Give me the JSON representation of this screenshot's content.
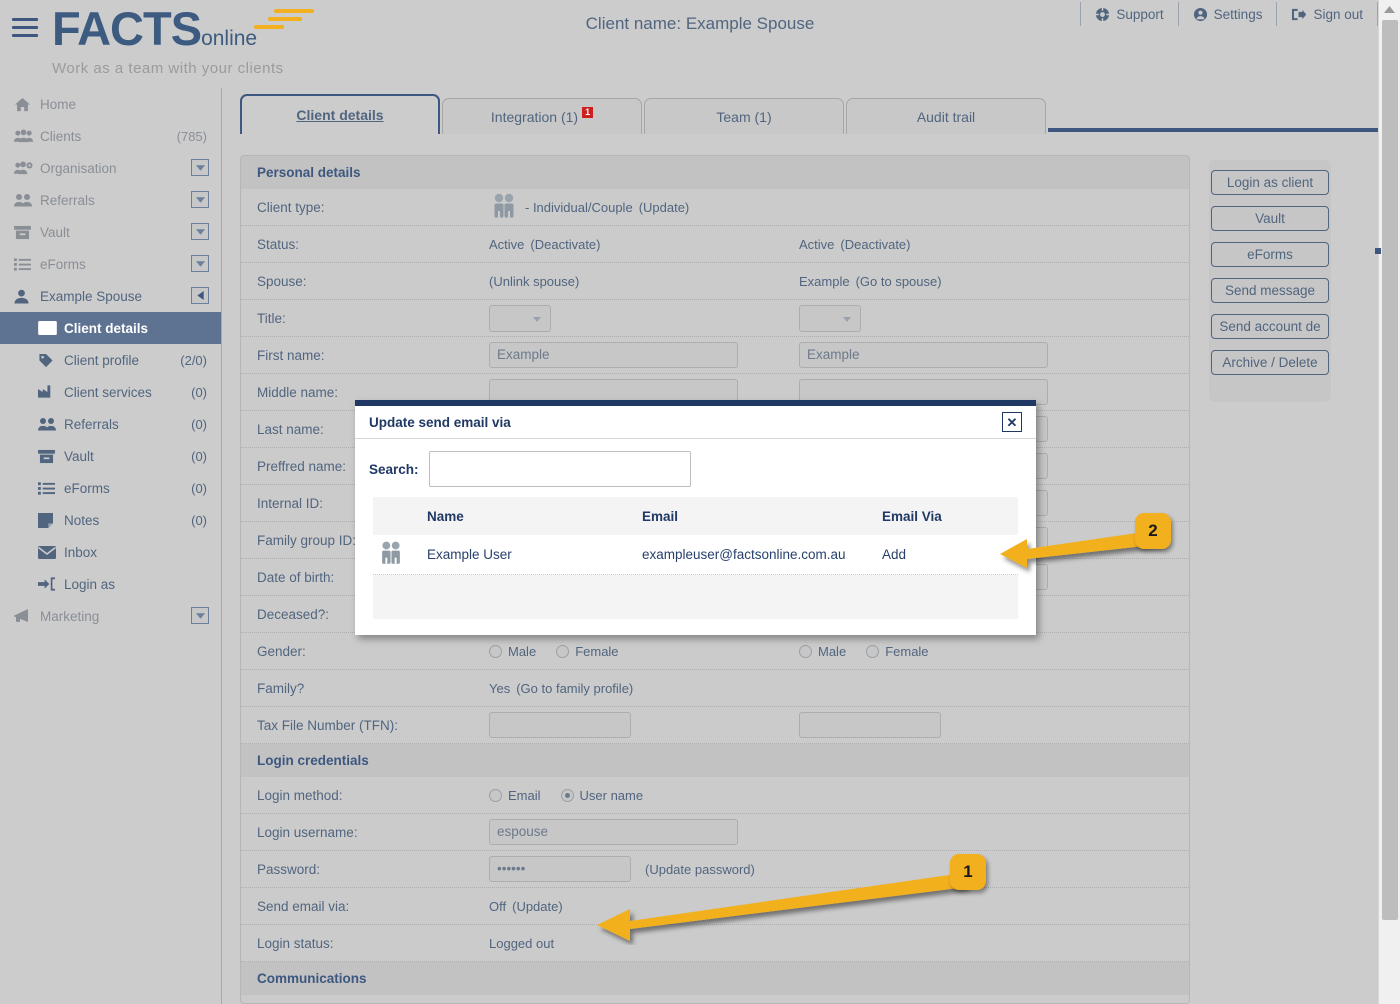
{
  "header": {
    "logo_main": "FACTS",
    "logo_sub": "online",
    "tagline": "Work as a team with your clients",
    "client_title": "Client name: Example Spouse",
    "links": [
      {
        "label": "Support",
        "icon": "lifebuoy-icon"
      },
      {
        "label": "Settings",
        "icon": "user-circle-icon"
      },
      {
        "label": "Sign out",
        "icon": "sign-out-icon"
      }
    ]
  },
  "sidebar": {
    "items": [
      {
        "label": "Home",
        "icon": "home-icon",
        "count": "",
        "caret": false,
        "level": "top"
      },
      {
        "label": "Clients",
        "icon": "people-icon",
        "count": "(785)",
        "caret": false,
        "level": "top"
      },
      {
        "label": "Organisation",
        "icon": "people-gear-icon",
        "count": "",
        "caret": true,
        "level": "top"
      },
      {
        "label": "Referrals",
        "icon": "two-people-icon",
        "count": "",
        "caret": true,
        "level": "top"
      },
      {
        "label": "Vault",
        "icon": "archive-icon",
        "count": "",
        "caret": true,
        "level": "top"
      },
      {
        "label": "eForms",
        "icon": "list-icon",
        "count": "",
        "caret": true,
        "level": "top"
      },
      {
        "label": "Example Spouse",
        "icon": "person-icon",
        "count": "",
        "caret": "left",
        "level": "client"
      },
      {
        "label": "Client details",
        "icon": "id-card-icon",
        "count": "",
        "caret": false,
        "level": "sub",
        "active": true
      },
      {
        "label": "Client profile",
        "icon": "tag-icon",
        "count": "(2/0)",
        "caret": false,
        "level": "sub"
      },
      {
        "label": "Client services",
        "icon": "factory-icon",
        "count": "(0)",
        "caret": false,
        "level": "sub"
      },
      {
        "label": "Referrals",
        "icon": "two-people-icon",
        "count": "(0)",
        "caret": false,
        "level": "sub"
      },
      {
        "label": "Vault",
        "icon": "archive-icon",
        "count": "(0)",
        "caret": false,
        "level": "sub"
      },
      {
        "label": "eForms",
        "icon": "list-icon",
        "count": "(0)",
        "caret": false,
        "level": "sub"
      },
      {
        "label": "Notes",
        "icon": "note-icon",
        "count": "(0)",
        "caret": false,
        "level": "sub"
      },
      {
        "label": "Inbox",
        "icon": "envelope-icon",
        "count": "",
        "caret": false,
        "level": "sub"
      },
      {
        "label": "Login as",
        "icon": "login-arrow-icon",
        "count": "",
        "caret": false,
        "level": "sub"
      },
      {
        "label": "Marketing",
        "icon": "megaphone-icon",
        "count": "",
        "caret": true,
        "level": "top"
      }
    ]
  },
  "tabs": [
    {
      "label": "Client details",
      "badge": "",
      "active": true
    },
    {
      "label": "Integration (1)",
      "badge": "1",
      "active": false
    },
    {
      "label": "Team (1)",
      "badge": "",
      "active": false
    },
    {
      "label": "Audit trail",
      "badge": "",
      "active": false
    }
  ],
  "personal_details": {
    "section_title": "Personal details",
    "rows": [
      {
        "label": "Client type:",
        "type": "clienttype",
        "icon": "couple-icon",
        "c1_text": "- Individual/Couple",
        "c1_link": "(Update)"
      },
      {
        "label": "Status:",
        "type": "textlink",
        "c1_text": "Active",
        "c1_link": "(Deactivate)",
        "c2_text": "Active",
        "c2_link": "(Deactivate)"
      },
      {
        "label": "Spouse:",
        "type": "textlink",
        "c1_text": "",
        "c1_link": "(Unlink spouse)",
        "c2_text": "Example",
        "c2_link": "(Go to spouse)"
      },
      {
        "label": "Title:",
        "type": "select",
        "c1_value": "",
        "c2_value": ""
      },
      {
        "label": "First name:",
        "type": "input",
        "c1_value": "Example",
        "c2_value": "Example"
      },
      {
        "label": "Middle name:",
        "type": "input",
        "c1_value": "",
        "c2_value": ""
      },
      {
        "label": "Last name:",
        "type": "input",
        "c1_value": "",
        "c2_value": ""
      },
      {
        "label": "Preffred name:",
        "type": "input",
        "c1_value": "",
        "c2_value": ""
      },
      {
        "label": "Internal ID:",
        "type": "input",
        "c1_value": "",
        "c2_value": ""
      },
      {
        "label": "Family group ID:",
        "type": "input",
        "c1_value": "",
        "c2_value": ""
      },
      {
        "label": "Date of birth:",
        "type": "input",
        "c1_value": "",
        "c2_value": ""
      },
      {
        "label": "Deceased?:",
        "type": "checkbox",
        "c1_value": "",
        "c2_value": ""
      },
      {
        "label": "Gender:",
        "type": "gender",
        "opt1": "Male",
        "opt2": "Female"
      },
      {
        "label": "Family?",
        "type": "textlink",
        "c1_text": "Yes",
        "c1_link": "(Go to family profile)",
        "c2_text": "",
        "c2_link": ""
      },
      {
        "label": "Tax File Number (TFN):",
        "type": "input-small",
        "c1_value": "",
        "c2_value": ""
      }
    ]
  },
  "login_credentials": {
    "section_title": "Login credentials",
    "login_method_label": "Login method:",
    "login_method_opt1": "Email",
    "login_method_opt2": "User name",
    "login_method_selected": "User name",
    "username_label": "Login username:",
    "username_value": "espouse",
    "password_label": "Password:",
    "password_value": "••••••",
    "password_link": "(Update password)",
    "send_email_label": "Send email via:",
    "send_email_value": "Off",
    "send_email_link": "(Update)",
    "login_status_label": "Login status:",
    "login_status_value": "Logged out"
  },
  "communications": {
    "section_title": "Communications"
  },
  "actions": {
    "buttons": [
      "Login as client",
      "Vault",
      "eForms",
      "Send message",
      "Send account de",
      "Archive / Delete"
    ]
  },
  "modal": {
    "title": "Update send email via",
    "close_label": "✕",
    "search_label": "Search:",
    "search_value": "",
    "search_placeholder": "",
    "columns": [
      "Name",
      "Email",
      "Email Via"
    ],
    "rows": [
      {
        "icon": "couple-icon",
        "name": "Example User",
        "email": "exampleuser@factsonline.com.au",
        "action": "Add"
      }
    ]
  },
  "annotations": [
    {
      "number": "1",
      "target": "send-email-via-update-link"
    },
    {
      "number": "2",
      "target": "modal-add-link"
    }
  ],
  "colors": {
    "page_bg": "#cccccc",
    "accent_navy": "#3d5780",
    "modal_navy": "#1f3864",
    "annotation_yellow": "#f2b01e",
    "badge_red": "#cc1f1f",
    "active_nav": "#5e7292"
  }
}
